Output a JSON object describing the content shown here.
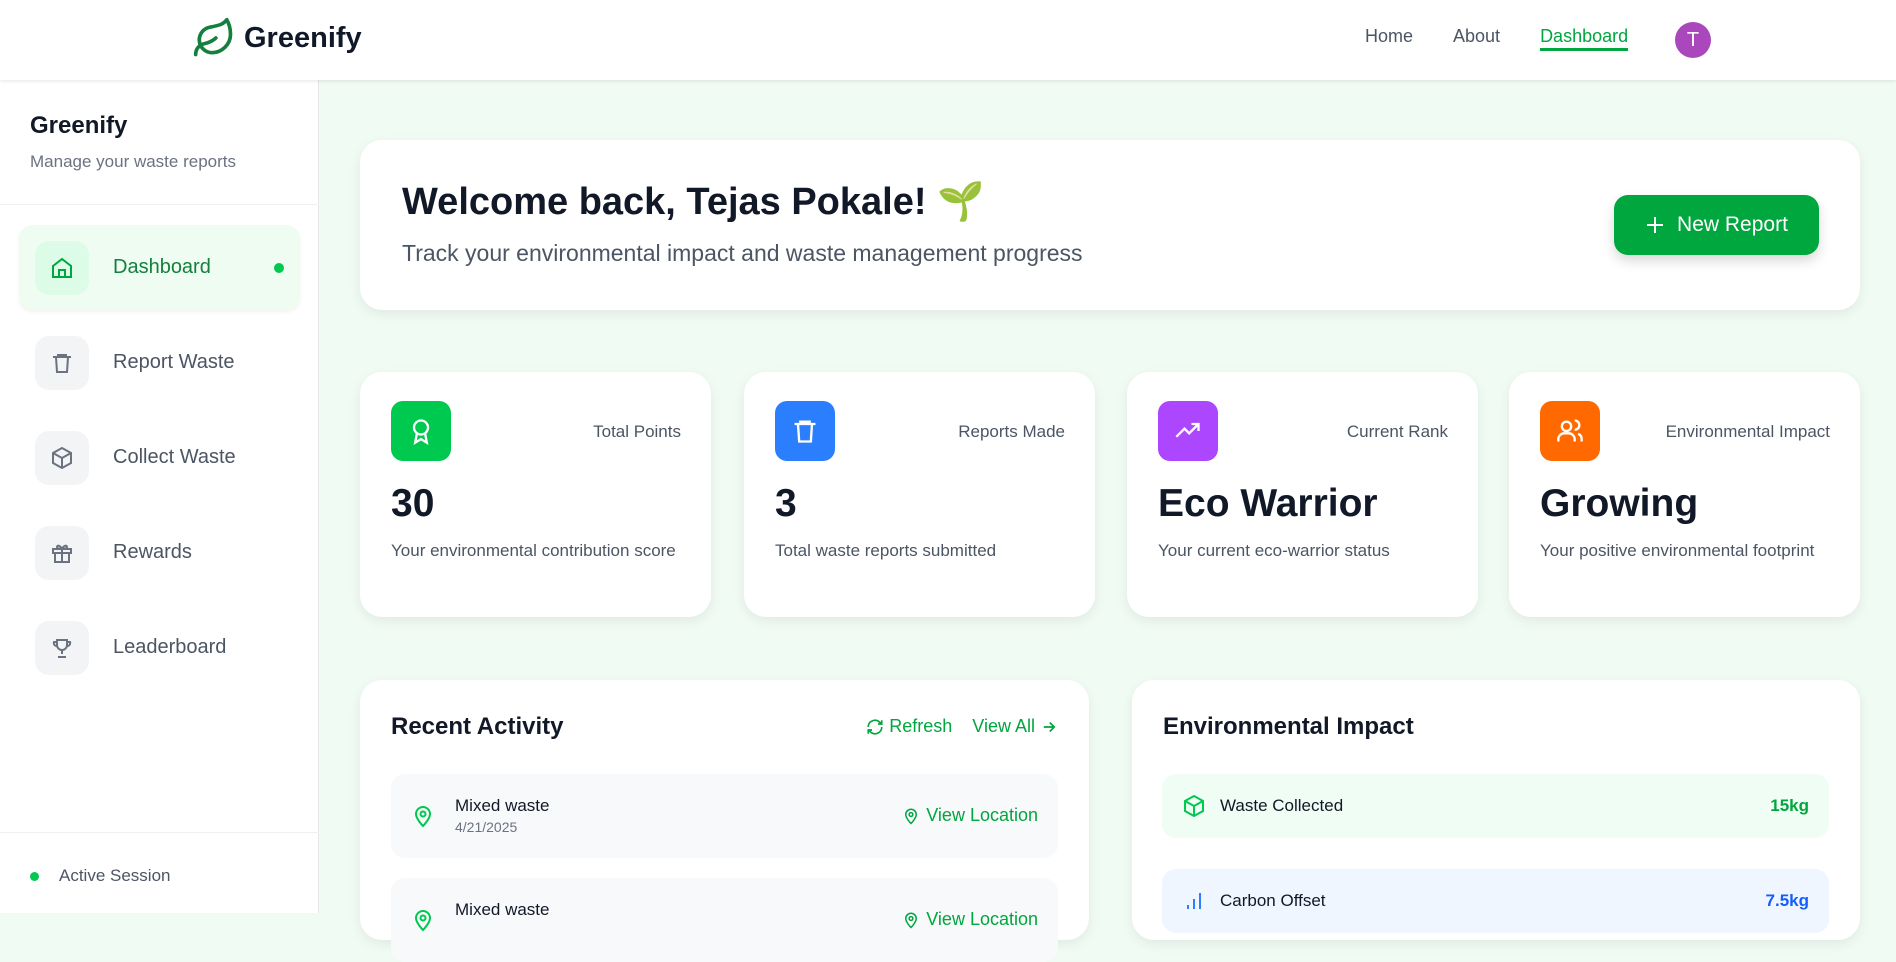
{
  "header": {
    "brand": "Greenify",
    "nav": [
      "Home",
      "About",
      "Dashboard"
    ],
    "avatar_initial": "T"
  },
  "sidebar": {
    "title": "Greenify",
    "subtitle": "Manage your waste reports",
    "items": [
      {
        "label": "Dashboard"
      },
      {
        "label": "Report Waste"
      },
      {
        "label": "Collect Waste"
      },
      {
        "label": "Rewards"
      },
      {
        "label": "Leaderboard"
      }
    ],
    "session": "Active Session"
  },
  "welcome": {
    "title": "Welcome back, Tejas Pokale! 🌱",
    "subtitle": "Track your environmental impact and waste management progress",
    "button": "New Report"
  },
  "stats": [
    {
      "label": "Total Points",
      "value": "30",
      "desc": "Your environmental contribution score",
      "color": "#00c950"
    },
    {
      "label": "Reports Made",
      "value": "3",
      "desc": "Total waste reports submitted",
      "color": "#2b7fff"
    },
    {
      "label": "Current Rank",
      "value": "Eco Warrior",
      "desc": "Your current eco-warrior status",
      "color": "#ad46ff"
    },
    {
      "label": "Environmental Impact",
      "value": "Growing",
      "desc": "Your positive environmental footprint",
      "color": "#ff6900"
    }
  ],
  "activity": {
    "title": "Recent Activity",
    "refresh": "Refresh",
    "view_all": "View All",
    "items": [
      {
        "title": "Mixed waste",
        "date": "4/21/2025",
        "action": "View Location"
      },
      {
        "title": "Mixed waste",
        "action": "View Location"
      }
    ]
  },
  "impact": {
    "title": "Environmental Impact",
    "items": [
      {
        "name": "Waste Collected",
        "value": "15kg"
      },
      {
        "name": "Carbon Offset",
        "value": "7.5kg"
      }
    ]
  }
}
